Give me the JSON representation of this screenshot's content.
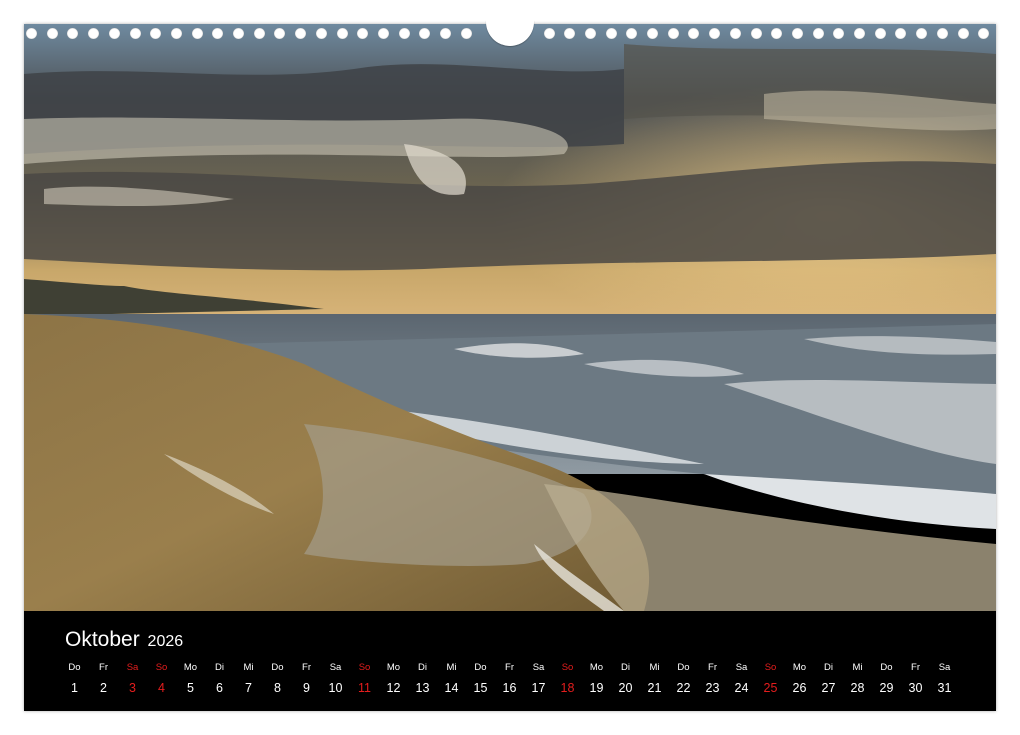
{
  "calendar": {
    "month": "Oktober",
    "year": "2026",
    "days": [
      {
        "wd": "Do",
        "d": "1",
        "we": false
      },
      {
        "wd": "Fr",
        "d": "2",
        "we": false
      },
      {
        "wd": "Sa",
        "d": "3",
        "we": true
      },
      {
        "wd": "So",
        "d": "4",
        "we": true
      },
      {
        "wd": "Mo",
        "d": "5",
        "we": false
      },
      {
        "wd": "Di",
        "d": "6",
        "we": false
      },
      {
        "wd": "Mi",
        "d": "7",
        "we": false
      },
      {
        "wd": "Do",
        "d": "8",
        "we": false
      },
      {
        "wd": "Fr",
        "d": "9",
        "we": false
      },
      {
        "wd": "Sa",
        "d": "10",
        "we": false
      },
      {
        "wd": "So",
        "d": "11",
        "we": true
      },
      {
        "wd": "Mo",
        "d": "12",
        "we": false
      },
      {
        "wd": "Di",
        "d": "13",
        "we": false
      },
      {
        "wd": "Mi",
        "d": "14",
        "we": false
      },
      {
        "wd": "Do",
        "d": "15",
        "we": false
      },
      {
        "wd": "Fr",
        "d": "16",
        "we": false
      },
      {
        "wd": "Sa",
        "d": "17",
        "we": false
      },
      {
        "wd": "So",
        "d": "18",
        "we": true
      },
      {
        "wd": "Mo",
        "d": "19",
        "we": false
      },
      {
        "wd": "Di",
        "d": "20",
        "we": false
      },
      {
        "wd": "Mi",
        "d": "21",
        "we": false
      },
      {
        "wd": "Do",
        "d": "22",
        "we": false
      },
      {
        "wd": "Fr",
        "d": "23",
        "we": false
      },
      {
        "wd": "Sa",
        "d": "24",
        "we": false
      },
      {
        "wd": "So",
        "d": "25",
        "we": true
      },
      {
        "wd": "Mo",
        "d": "26",
        "we": false
      },
      {
        "wd": "Di",
        "d": "27",
        "we": false
      },
      {
        "wd": "Mi",
        "d": "28",
        "we": false
      },
      {
        "wd": "Do",
        "d": "29",
        "we": false
      },
      {
        "wd": "Fr",
        "d": "30",
        "we": false
      },
      {
        "wd": "Sa",
        "d": "31",
        "we": false
      }
    ]
  },
  "colors": {
    "weekend": "#e41d1d",
    "text": "#ffffff",
    "band": "#000000"
  }
}
